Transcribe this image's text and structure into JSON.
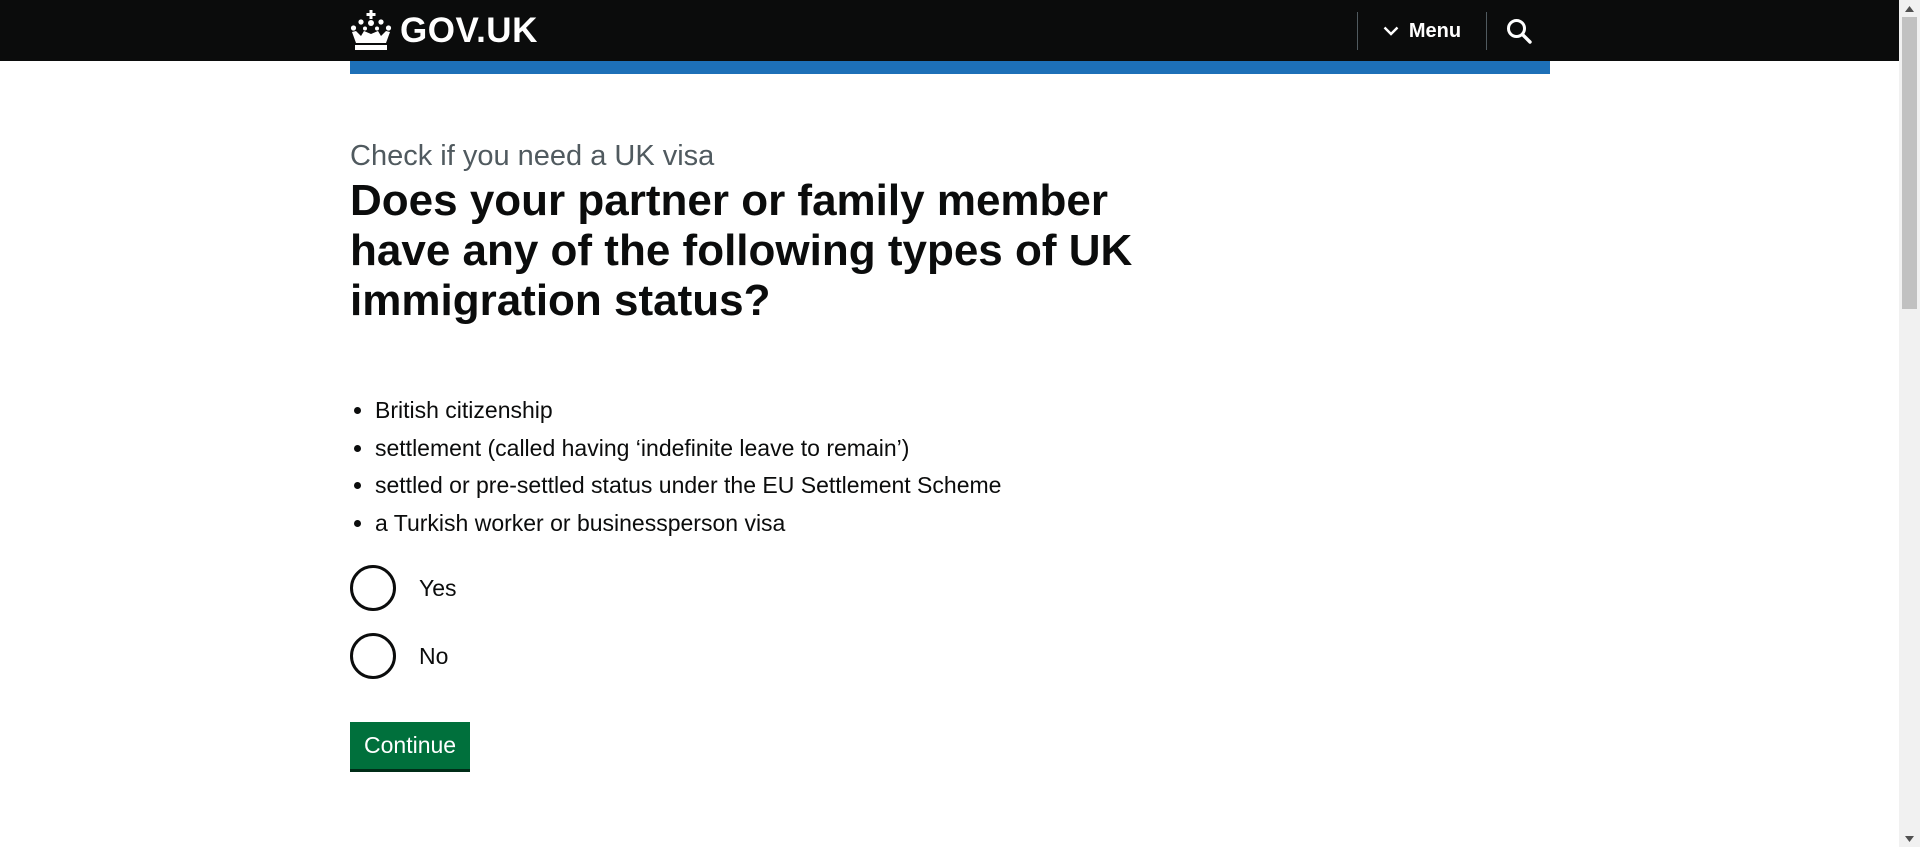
{
  "header": {
    "logo_text": "GOV.UK",
    "logo_icon": "crown-icon",
    "menu_label": "Menu",
    "menu_icon": "chevron-down-icon",
    "search_icon": "search-icon",
    "background_color": "#0b0c0c",
    "accent_bar_color": "#1d70b8"
  },
  "main": {
    "caption": "Check if you need a UK visa",
    "question": "Does your partner or family member have any of the following types of UK immigration status?",
    "status_list": [
      "British citizenship",
      "settlement (called having ‘indefinite leave to remain’)",
      "settled or pre-settled status under the EU Settlement Scheme",
      "a Turkish worker or businessperson visa"
    ],
    "options": [
      {
        "label": "Yes",
        "selected": false
      },
      {
        "label": "No",
        "selected": false
      }
    ],
    "continue_label": "Continue",
    "continue_color": "#00703c"
  }
}
